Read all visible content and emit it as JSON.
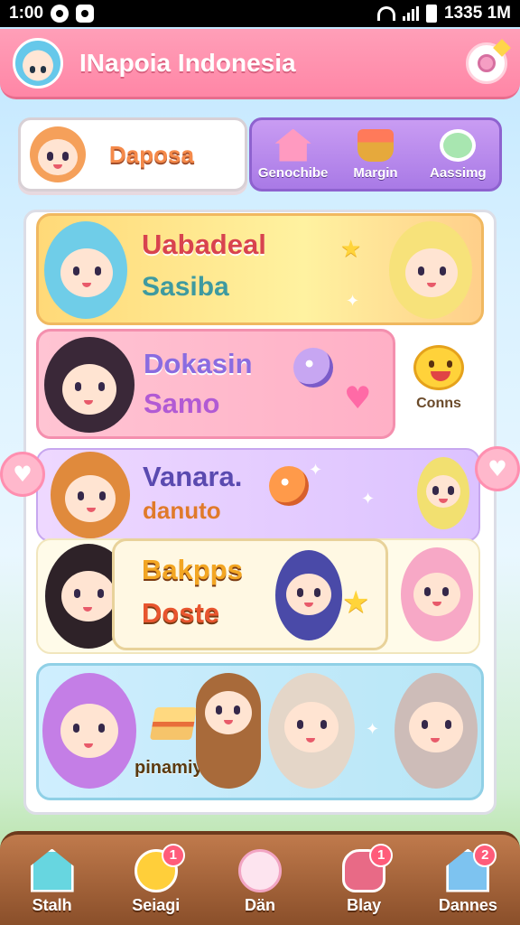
{
  "status_bar": {
    "time": "1:00",
    "right_time": "1335 1M"
  },
  "header": {
    "title": "INapoia Indonesia"
  },
  "profile": {
    "name": "Daposa"
  },
  "menu": [
    {
      "label": "Genochibe",
      "icon": "house-icon"
    },
    {
      "label": "Margin",
      "icon": "flower-basket-icon"
    },
    {
      "label": "Aassimg",
      "icon": "swirl-icon"
    }
  ],
  "cards": [
    {
      "title": "Uabadeal",
      "subtitle": "Sasiba"
    },
    {
      "title": "Dokasin",
      "subtitle": "Samo"
    },
    {
      "title": "Vanara.",
      "subtitle": "danuto"
    },
    {
      "title": "Bakpps",
      "subtitle": "Doste"
    },
    {
      "title": "",
      "subtitle": "pinamiy"
    }
  ],
  "side": {
    "label": "Conns"
  },
  "nav": [
    {
      "label": "Stalh",
      "badge": ""
    },
    {
      "label": "Seiagi",
      "badge": "1"
    },
    {
      "label": "Dän",
      "badge": ""
    },
    {
      "label": "Blay",
      "badge": "1"
    },
    {
      "label": "Dannes",
      "badge": "2"
    }
  ]
}
